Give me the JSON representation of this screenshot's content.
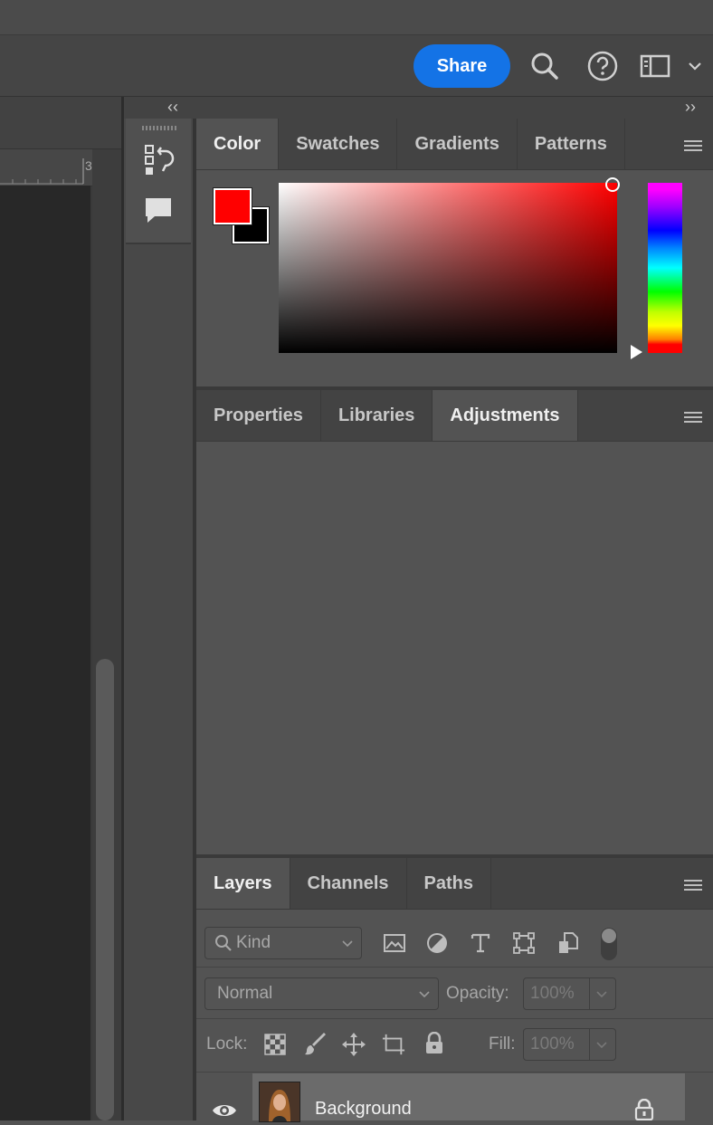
{
  "toolbar": {
    "share_label": "Share",
    "icons": [
      "search-icon",
      "help-icon",
      "workspace-icon",
      "chevron-down-icon"
    ]
  },
  "ruler": {
    "tick_label": "3"
  },
  "collapse": {
    "left": "‹‹",
    "right": "››"
  },
  "color_panel": {
    "tabs": [
      "Color",
      "Swatches",
      "Gradients",
      "Patterns"
    ],
    "active_tab": "Color",
    "foreground_color": "#ff0000",
    "background_color": "#000000"
  },
  "adjustments_panel": {
    "tabs": [
      "Properties",
      "Libraries",
      "Adjustments"
    ],
    "active_tab": "Adjustments"
  },
  "layers_panel": {
    "tabs": [
      "Layers",
      "Channels",
      "Paths"
    ],
    "active_tab": "Layers",
    "filter_kind": "Kind",
    "blend_mode": "Normal",
    "opacity_label": "Opacity:",
    "opacity_value": "100%",
    "lock_label": "Lock:",
    "fill_label": "Fill:",
    "fill_value": "100%",
    "layers": [
      {
        "name": "Background",
        "visible": true,
        "locked": true
      }
    ]
  },
  "colors": {
    "accent": "#1473e6"
  }
}
